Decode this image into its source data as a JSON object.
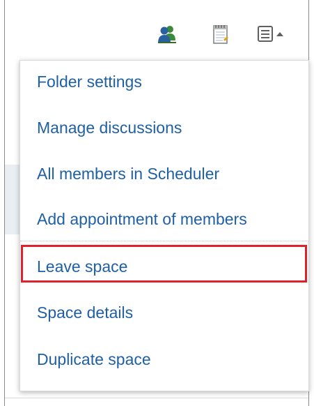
{
  "toolbar": {
    "members_icon": "members-icon",
    "memo_icon": "memo-icon",
    "menu_icon": "menu-list-icon",
    "menu_caret": "caret-up-icon"
  },
  "menu": {
    "items": [
      {
        "label": "Folder settings"
      },
      {
        "label": "Manage discussions"
      },
      {
        "label": "All members in Scheduler"
      },
      {
        "label": "Add appointment of members"
      },
      {
        "label": "Leave space"
      },
      {
        "label": "Space details"
      },
      {
        "label": "Duplicate space"
      }
    ],
    "highlighted_label": "Leave space"
  },
  "colors": {
    "link": "#1f5fa6",
    "highlight": "#e0202a",
    "members_icon_green": "#3a8a3a",
    "members_icon_blue": "#2a5fa0"
  }
}
